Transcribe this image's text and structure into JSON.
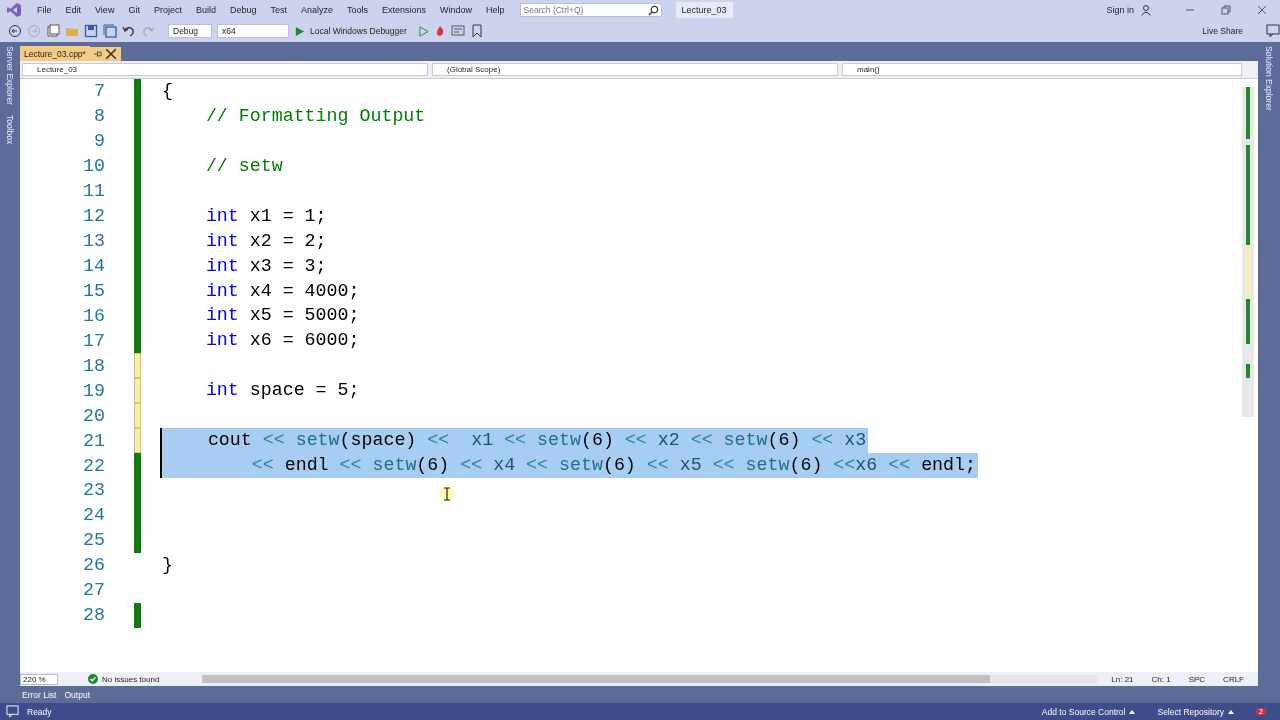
{
  "menu": [
    {
      "label": "File"
    },
    {
      "label": "Edit"
    },
    {
      "label": "View"
    },
    {
      "label": "Git"
    },
    {
      "label": "Project"
    },
    {
      "label": "Build"
    },
    {
      "label": "Debug"
    },
    {
      "label": "Test"
    },
    {
      "label": "Analyze"
    },
    {
      "label": "Tools"
    },
    {
      "label": "Extensions"
    },
    {
      "label": "Window"
    },
    {
      "label": "Help"
    }
  ],
  "search": {
    "placeholder": "Search (Ctrl+Q)"
  },
  "solution_title": "Lecture_03",
  "sign_in": "Sign in",
  "toolbar": {
    "configuration": "Debug",
    "platform": "x64",
    "debugger": "Local Windows Debugger",
    "live_share": "Live Share"
  },
  "side_panels": {
    "left": [
      "Server Explorer",
      "Toolbox"
    ],
    "right": [
      "Solution Explorer"
    ]
  },
  "tabs": [
    {
      "label": "Lecture_03.cpp*",
      "selected": true
    }
  ],
  "nav_bar": {
    "project": "Lecture_03",
    "scope": "(Global Scope)",
    "member": "main()"
  },
  "editor": {
    "lines": [
      {
        "number": "7",
        "modified": true,
        "saved": true,
        "selected": false,
        "tokens": [
          {
            "text": "{",
            "kind": "plain"
          }
        ]
      },
      {
        "number": "8",
        "modified": true,
        "saved": true,
        "selected": false,
        "tokens": [
          {
            "text": "    // Formatting Output",
            "kind": "comment"
          }
        ]
      },
      {
        "number": "9",
        "modified": true,
        "saved": true,
        "selected": false
      },
      {
        "number": "10",
        "modified": true,
        "saved": true,
        "selected": false,
        "tokens": [
          {
            "text": "    // setw",
            "kind": "comment"
          }
        ]
      },
      {
        "number": "11",
        "modified": true,
        "saved": true,
        "selected": false
      },
      {
        "number": "12",
        "modified": true,
        "saved": true,
        "selected": false,
        "tokens": [
          {
            "text": "    int",
            "kind": "kw"
          },
          {
            "text": " x1 = 1;",
            "kind": "plain"
          }
        ]
      },
      {
        "number": "13",
        "modified": true,
        "saved": true,
        "selected": false,
        "tokens": [
          {
            "text": "    int",
            "kind": "kw"
          },
          {
            "text": " x2 = 2;",
            "kind": "plain"
          }
        ]
      },
      {
        "number": "14",
        "modified": true,
        "saved": true,
        "selected": false,
        "tokens": [
          {
            "text": "    int",
            "kind": "kw"
          },
          {
            "text": " x3 = 3;",
            "kind": "plain"
          }
        ]
      },
      {
        "number": "15",
        "modified": true,
        "saved": true,
        "selected": false,
        "tokens": [
          {
            "text": "    int",
            "kind": "kw"
          },
          {
            "text": " x4 = 4000;",
            "kind": "plain"
          }
        ]
      },
      {
        "number": "16",
        "modified": true,
        "saved": true,
        "selected": false,
        "tokens": [
          {
            "text": "    int",
            "kind": "kw"
          },
          {
            "text": " x5 = 5000;",
            "kind": "plain"
          }
        ]
      },
      {
        "number": "17",
        "modified": true,
        "saved": true,
        "selected": false,
        "tokens": [
          {
            "text": "    int",
            "kind": "kw"
          },
          {
            "text": " x6 = 6000;",
            "kind": "plain"
          }
        ]
      },
      {
        "number": "18",
        "modified": true,
        "saved": false,
        "selected": false
      },
      {
        "number": "19",
        "modified": true,
        "saved": false,
        "selected": false,
        "tokens": [
          {
            "text": "    int",
            "kind": "kw"
          },
          {
            "text": " space = 5;",
            "kind": "plain"
          }
        ]
      },
      {
        "number": "20",
        "modified": true,
        "saved": false,
        "selected": false
      },
      {
        "number": "21",
        "modified": true,
        "saved": false,
        "selected": true,
        "tokens": [
          {
            "text": "    cout",
            "kind": "plain"
          },
          {
            "text": " << ",
            "kind": "op"
          },
          {
            "text": "setw",
            "kind": "func"
          },
          {
            "text": "(space) ",
            "kind": "plain"
          },
          {
            "text": "<<",
            "kind": "op"
          },
          {
            "text": "  x1 ",
            "kind": "var"
          },
          {
            "text": "<<",
            "kind": "op"
          },
          {
            "text": " setw",
            "kind": "func"
          },
          {
            "text": "(6) ",
            "kind": "plain"
          },
          {
            "text": "<<",
            "kind": "op"
          },
          {
            "text": " x2 ",
            "kind": "var"
          },
          {
            "text": "<<",
            "kind": "op"
          },
          {
            "text": " setw",
            "kind": "func"
          },
          {
            "text": "(6) ",
            "kind": "plain"
          },
          {
            "text": "<<",
            "kind": "op"
          },
          {
            "text": " x3",
            "kind": "var"
          }
        ]
      },
      {
        "number": "22",
        "modified": true,
        "saved": true,
        "selected": true,
        "tokens": [
          {
            "text": "        <<",
            "kind": "op"
          },
          {
            "text": " endl ",
            "kind": "plain"
          },
          {
            "text": "<<",
            "kind": "op"
          },
          {
            "text": " setw",
            "kind": "func"
          },
          {
            "text": "(6) ",
            "kind": "plain"
          },
          {
            "text": "<<",
            "kind": "op"
          },
          {
            "text": " x4 ",
            "kind": "var"
          },
          {
            "text": "<<",
            "kind": "op"
          },
          {
            "text": " setw",
            "kind": "func"
          },
          {
            "text": "(6) ",
            "kind": "plain"
          },
          {
            "text": "<<",
            "kind": "op"
          },
          {
            "text": " x5 ",
            "kind": "var"
          },
          {
            "text": "<<",
            "kind": "op"
          },
          {
            "text": " setw",
            "kind": "func"
          },
          {
            "text": "(6) ",
            "kind": "plain"
          },
          {
            "text": "<<",
            "kind": "op"
          },
          {
            "text": "x6 ",
            "kind": "var"
          },
          {
            "text": "<<",
            "kind": "op"
          },
          {
            "text": " endl;",
            "kind": "plain"
          }
        ]
      },
      {
        "number": "23",
        "modified": true,
        "saved": true,
        "selected": false
      },
      {
        "number": "24",
        "modified": true,
        "saved": true,
        "selected": false
      },
      {
        "number": "25",
        "modified": true,
        "saved": true,
        "selected": false
      },
      {
        "number": "26",
        "modified": false,
        "selected": false,
        "tokens": [
          {
            "text": "}",
            "kind": "plain"
          }
        ]
      },
      {
        "number": "27",
        "modified": false,
        "selected": false
      },
      {
        "number": "28",
        "modified": true,
        "saved": true,
        "selected": false
      }
    ]
  },
  "editor_status": {
    "zoom": "220 %",
    "issues": "No issues found",
    "line": "Ln: 21",
    "column": "Ch: 1",
    "whitespace": "SPC",
    "line_ending": "CRLF"
  },
  "tool_tabs": [
    {
      "label": "Error List"
    },
    {
      "label": "Output"
    }
  ],
  "status_bar": {
    "state": "Ready",
    "source_control": "Add to Source Control",
    "repository": "Select Repository",
    "notifications": "2"
  }
}
